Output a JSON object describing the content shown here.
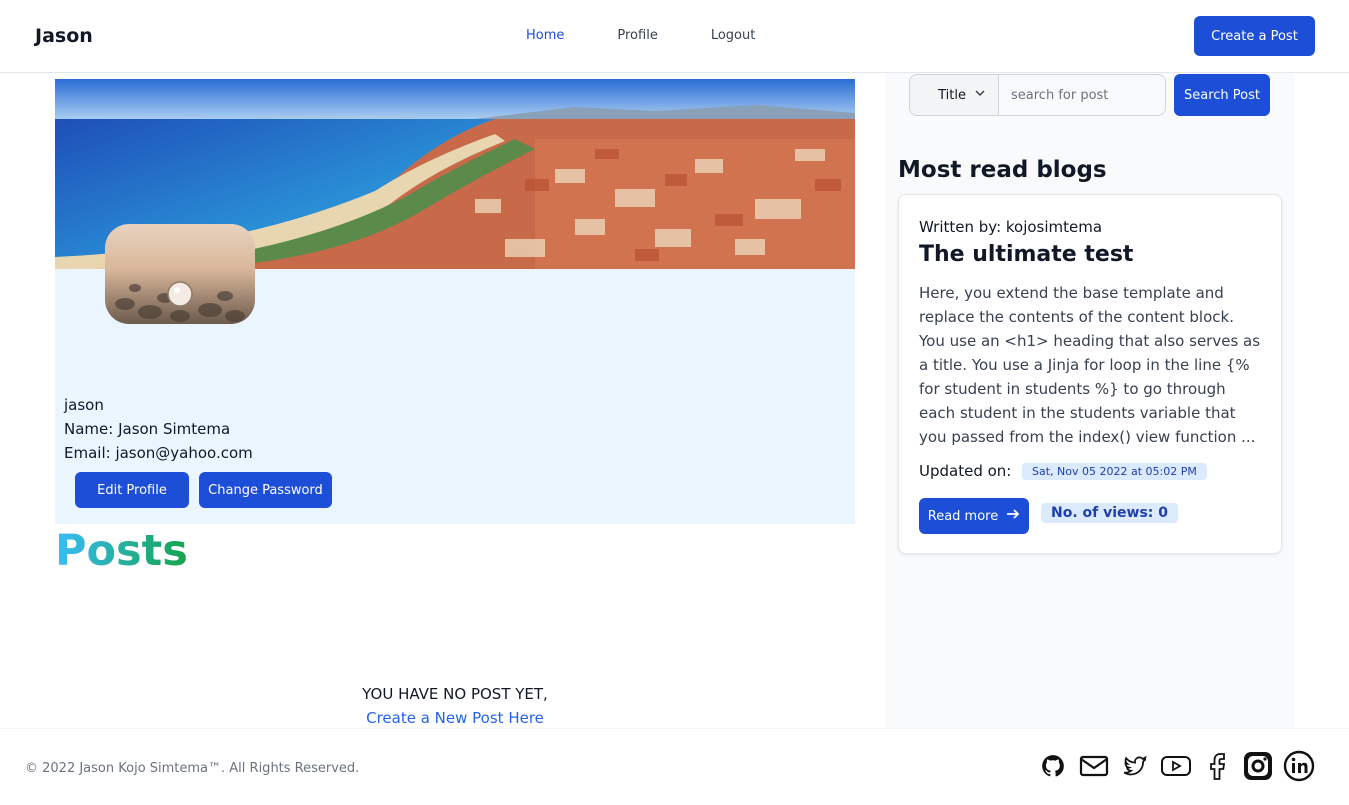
{
  "nav": {
    "brand": "Jason",
    "links": [
      "Home",
      "Profile",
      "Logout"
    ],
    "create_button": "Create a Post"
  },
  "profile": {
    "username": "jason",
    "name_line": "Name: Jason Simtema",
    "email_line": "Email: jason@yahoo.com",
    "edit_button": "Edit Profile",
    "password_button": "Change Password"
  },
  "posts": {
    "title": "Posts",
    "empty_message": "YOU HAVE NO POST YET,",
    "create_link": "Create a New Post Here"
  },
  "sidebar": {
    "search_select": "Title",
    "search_placeholder": "search for post",
    "search_button": "Search Post",
    "heading": "Most read blogs",
    "blog": {
      "written_by": "Written by: kojosimtema",
      "title": "The ultimate test",
      "excerpt": "Here, you extend the base template and replace the contents of the content block. You use an <h1> heading that also serves as a title. You use a Jinja for loop in the line {% for student in students %} to go through each student in the students variable that you passed from the index() view function ...",
      "updated_label": "Updated on:",
      "updated_date": "Sat, Nov 05 2022 at 05:02 PM",
      "read_more": "Read more",
      "views": "No. of views: 0"
    }
  },
  "footer": {
    "copyright": "© 2022 Jason Kojo Simtema™. All Rights Reserved.",
    "icons": [
      "github-icon",
      "mail-icon",
      "twitter-icon",
      "youtube-icon",
      "facebook-icon",
      "instagram-icon",
      "linkedin-icon"
    ]
  },
  "colors": {
    "primary": "#1d4ed8",
    "profile_bg": "#ebf5ff",
    "badge_bg": "#dbeafe"
  }
}
